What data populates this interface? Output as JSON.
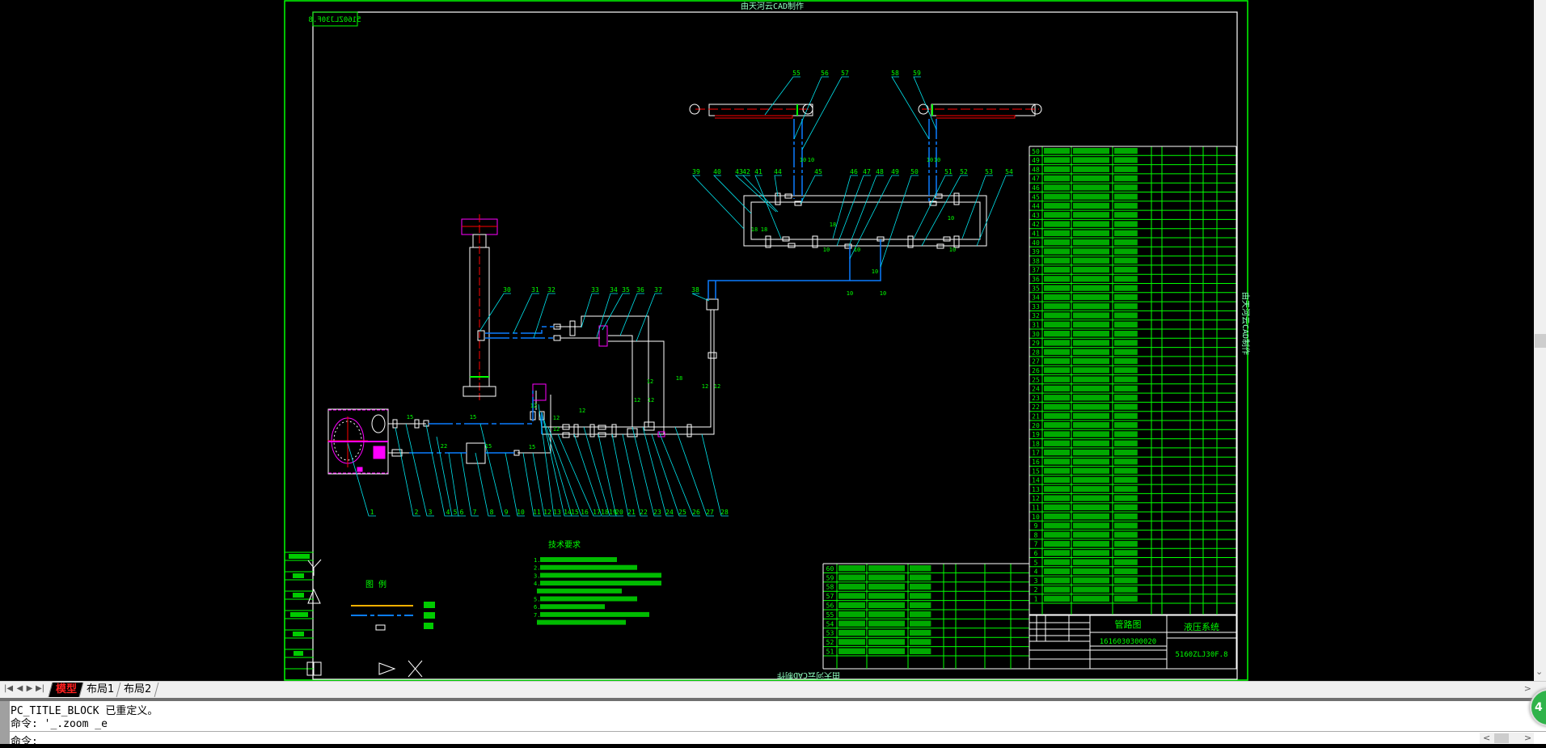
{
  "drawing": {
    "watermark": "由天河云CAD制作",
    "drawing_code": "5160ZLJ30F.8",
    "title_block": {
      "drawing_name": "管路图",
      "part_code": "1616030300020",
      "system_name": "液压系统",
      "drawing_number": "5160ZLJ30F.8"
    },
    "tech_requirements_title": "技术要求",
    "tech_requirements_numbers": [
      "1.",
      "2.",
      "3.",
      "4.",
      "",
      "5.",
      "6.",
      "7.",
      ""
    ],
    "legend_title": "图  例",
    "balloons_bottom": [
      "1",
      "2",
      "3",
      "4",
      "5",
      "6",
      "7",
      "8",
      "9",
      "10",
      "11",
      "12",
      "13",
      "14",
      "15",
      "16",
      "17",
      "18",
      "19",
      "20",
      "21",
      "22",
      "23",
      "24",
      "25",
      "26",
      "27",
      "28"
    ],
    "balloons_mid": [
      "30",
      "31",
      "32",
      "33",
      "34",
      "35",
      "36",
      "37",
      "38"
    ],
    "balloons_top": [
      "55",
      "56",
      "57",
      "58",
      "59"
    ],
    "balloons_loop": [
      "39",
      "40",
      "43",
      "42",
      "41",
      "44",
      "45",
      "46",
      "47",
      "48",
      "49",
      "50",
      "51",
      "52",
      "53",
      "54"
    ],
    "pipe_labels": [
      "15",
      "15",
      "22",
      "15",
      "15",
      "12",
      "12",
      "12",
      "12",
      "12",
      "12",
      "12",
      "18",
      "12",
      "12",
      "10",
      "10",
      "10",
      "10",
      "18",
      "18",
      "18",
      "10",
      "10",
      "10",
      "10",
      "10",
      "10",
      "10"
    ],
    "parts_list_rows": [
      "50",
      "49",
      "48",
      "47",
      "46",
      "45",
      "44",
      "43",
      "42",
      "41",
      "40",
      "39",
      "38",
      "37",
      "36",
      "35",
      "34",
      "33",
      "32",
      "31",
      "30",
      "29",
      "28",
      "27",
      "26",
      "25",
      "24",
      "23",
      "22",
      "21",
      "20",
      "19",
      "18",
      "17",
      "16",
      "15",
      "14",
      "13",
      "12",
      "11",
      "10",
      "9",
      "8",
      "7",
      "6",
      "5",
      "4",
      "3",
      "2",
      "1"
    ],
    "lower_list_rows": [
      "60",
      "59",
      "58",
      "57",
      "56",
      "55",
      "54",
      "53",
      "52",
      "51"
    ]
  },
  "tabs": {
    "items": [
      {
        "label": "模型",
        "active": true
      },
      {
        "label": "布局1",
        "active": false
      },
      {
        "label": "布局2",
        "active": false
      }
    ]
  },
  "command": {
    "history": [
      "PC_TITLE_BLOCK 已重定义。",
      "命令: '_.zoom _e"
    ],
    "prompt": "命令:"
  },
  "badge": {
    "text": "4"
  },
  "colors": {
    "frame": "#00ff00",
    "drawing_lines": "#ffffff",
    "hose": "#0a7cff",
    "leader": "#00e5ee",
    "center": "#ff0000",
    "accent": "#ff00ff",
    "legend_steel": "#ffb000"
  }
}
